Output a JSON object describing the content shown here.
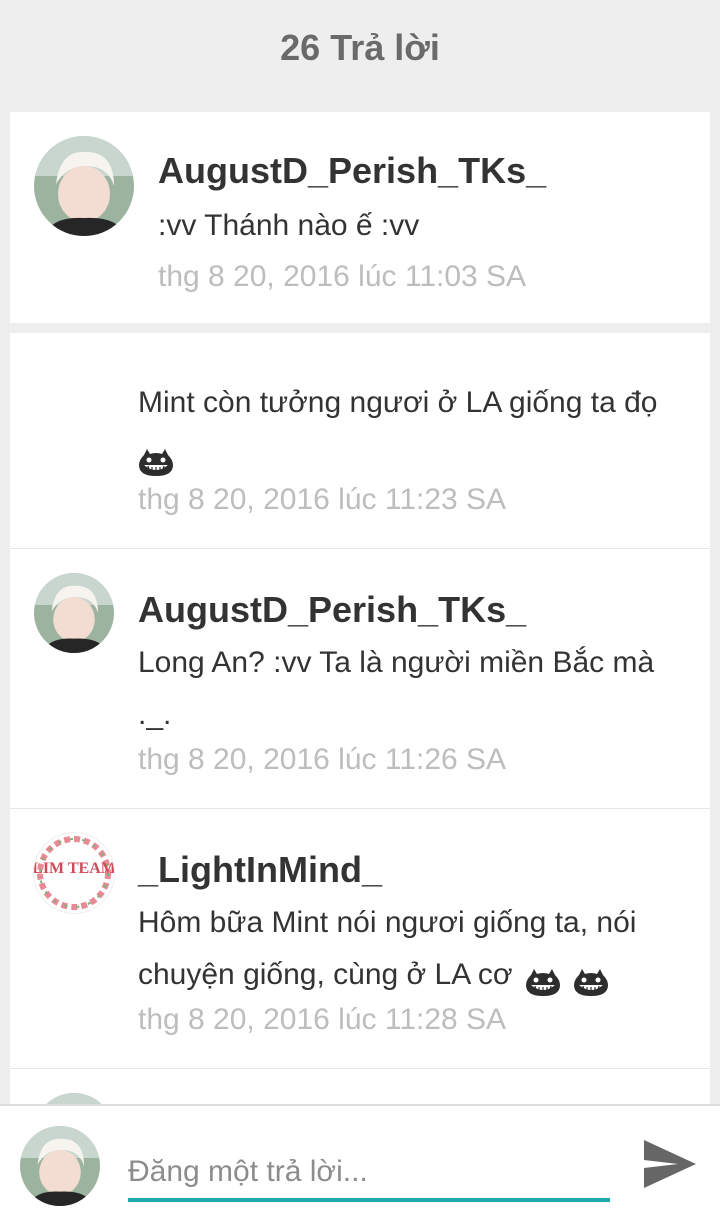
{
  "header": {
    "title": "26 Trả lời"
  },
  "parent_post": {
    "username": "AugustD_Perish_TKs_",
    "text": ":vv Thánh nào ế :vv",
    "timestamp": "thg 8 20, 2016 lúc 11:03 SA"
  },
  "replies": [
    {
      "username": "",
      "text": "Mint còn tưởng ngươi ở LA giống ta đọ",
      "emoji": [
        "grin-emoji"
      ],
      "timestamp": "thg 8 20, 2016 lúc 11:23 SA"
    },
    {
      "username": "AugustD_Perish_TKs_",
      "text": "Long An? :vv Ta là người miền Bắc mà ._.",
      "timestamp": "thg 8 20, 2016 lúc 11:26 SA"
    },
    {
      "username": "_LightInMind_",
      "text": "Hôm bữa Mint nói ngươi giống ta, nói chuyện giống, cùng ở LA cơ",
      "emoji": [
        "grin-emoji",
        "grin-emoji"
      ],
      "timestamp": "thg 8 20, 2016 lúc 11:28 SA",
      "avatar_text": "LIM TEAM"
    }
  ],
  "composer": {
    "placeholder": "Đăng một trả lời..."
  },
  "colors": {
    "accent": "#1fa9a9",
    "background": "#eeeeee",
    "timestamp": "#bdbdbd"
  }
}
